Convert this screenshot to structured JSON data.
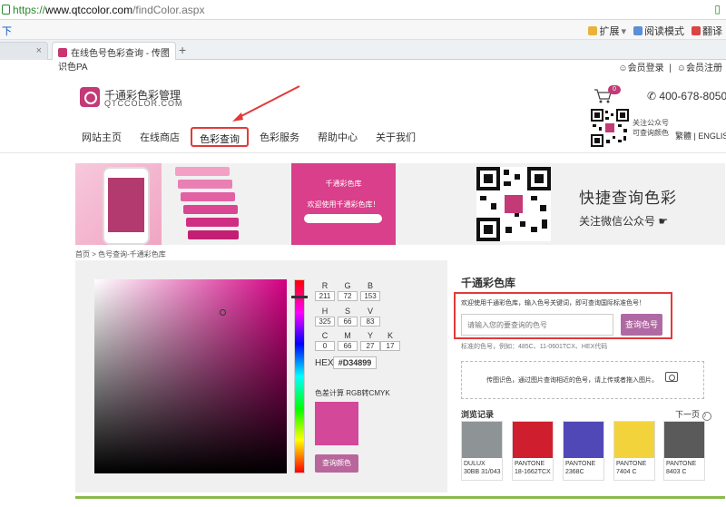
{
  "browser": {
    "url_scheme": "https://",
    "url_host": "www.qtccolor.com",
    "url_path": "/findColor.aspx",
    "bookmark_left": "下",
    "tools": [
      "扩展",
      "阅读模式",
      "翻译"
    ],
    "tabs": [
      {
        "label": ""
      },
      {
        "label": "在线色号色彩查询 - 传图识色PA"
      }
    ],
    "new_tab": "+",
    "close": "×"
  },
  "header": {
    "login": "会员登录",
    "separator": "|",
    "register": "会员注册",
    "logo_cn": "千通彩色彩管理",
    "logo_en": "QTCCOLOR.COM",
    "cart_count": "0",
    "phone": "400-678-8050",
    "qr_text_1": "关注公众号",
    "qr_text_2": "可查询颜色",
    "lang_trad": "繁體",
    "lang_sep": "|",
    "lang_en": "ENGLISH"
  },
  "nav": {
    "items": [
      "网站主页",
      "在线商店",
      "色彩查询",
      "色彩服务",
      "帮助中心",
      "关于我们"
    ],
    "active_index": 2
  },
  "banner": {
    "phone_header": "千通彩色库",
    "phone_welcome": "欢迎使用千通彩色库！",
    "title": "快捷查询色彩",
    "subtitle": "关注微信公众号"
  },
  "breadcrumb": {
    "home": "首页",
    "sep": ">",
    "current": "色号查询-千通彩色库"
  },
  "picker": {
    "rgb_labels": [
      "R",
      "G",
      "B"
    ],
    "rgb_values": [
      "211",
      "72",
      "153"
    ],
    "hsv_labels": [
      "H",
      "S",
      "V"
    ],
    "hsv_values": [
      "325",
      "66",
      "83"
    ],
    "cmyk_labels": [
      "C",
      "M",
      "Y",
      "K"
    ],
    "cmyk_values": [
      "0",
      "66",
      "27",
      "17"
    ],
    "hex_label": "HEX",
    "hex_value": "#D34899",
    "calc_label": "色差计算 RGB转CMYK",
    "preview_color": "#D34899",
    "query_button": "查询颜色"
  },
  "library": {
    "title": "千通彩色库",
    "hint": "欢迎使用千通彩色库，输入色号关键词，即可查询国际标准色号！",
    "placeholder": "请输入您的要查询的色号",
    "search_button": "查询色号",
    "std_colors": "标准的色号，例如：485C、11-0601TCX、HEX代码",
    "upload_text": "传图识色，通过图片查询相近的色号，请上传或者拖入图片。",
    "history_title": "浏览记录",
    "next_page": "下一页",
    "next_chevron": "〉",
    "history": [
      {
        "line1": "DULUX",
        "line2": "30BB 31/043",
        "color": "#8e9396"
      },
      {
        "line1": "PANTONE",
        "line2": "18-1662TCX",
        "color": "#cf1f2e"
      },
      {
        "line1": "PANTONE",
        "line2": "2368C",
        "color": "#5148b8"
      },
      {
        "line1": "PANTONE",
        "line2": "7404 C",
        "color": "#f2d33b"
      },
      {
        "line1": "PANTONE",
        "line2": "8403 C",
        "color": "#5a5a5a"
      }
    ]
  },
  "colors": {
    "brand": "#c33a77",
    "highlight": "#e23a3a",
    "button": "#b06aa3",
    "bottom_rule": "#8bb94d"
  }
}
